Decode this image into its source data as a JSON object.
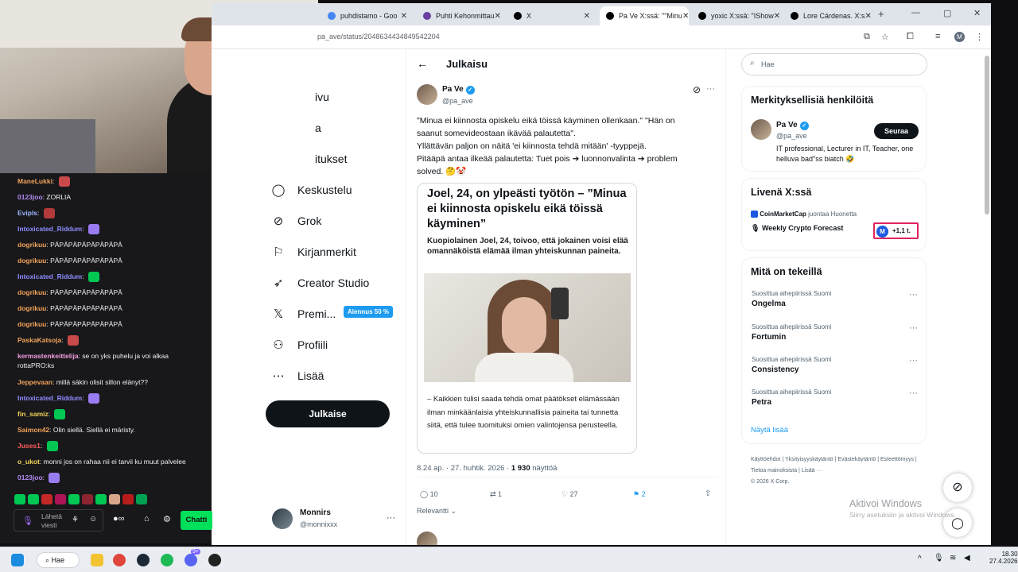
{
  "browser": {
    "tabs": [
      {
        "title": "puhdistamo - Goo",
        "color": "#4285f4"
      },
      {
        "title": "Puhti Kehonmittau",
        "color": "#6b3fa0"
      },
      {
        "title": "X",
        "color": "#000000"
      },
      {
        "title": "Pa Ve X:ssä: \"\"Minu",
        "color": "#000000"
      },
      {
        "title": "yoxic X:ssä: \"IShow",
        "color": "#000000"
      },
      {
        "title": "Lore Cárdenas. X:s",
        "color": "#000000"
      }
    ],
    "url": "pa_ave/status/2048634434849542204",
    "profile_letter": "M"
  },
  "nav": {
    "items": [
      {
        "label": "ivu",
        "icon": "home-icon"
      },
      {
        "label": "a",
        "icon": "explore-icon"
      },
      {
        "label": "itukset",
        "icon": "notifications-icon"
      },
      {
        "label": "Keskustelu",
        "icon": "chat-icon",
        "glyph": "◯"
      },
      {
        "label": "Grok",
        "icon": "grok-icon",
        "glyph": "⊘"
      },
      {
        "label": "Kirjanmerkit",
        "icon": "bookmark-icon",
        "glyph": "⚐"
      },
      {
        "label": "Creator Studio",
        "icon": "rocket-icon",
        "glyph": "➶"
      },
      {
        "label": "Premi...",
        "icon": "x-logo-icon",
        "glyph": "𝕏"
      },
      {
        "label": "Profiili",
        "icon": "profile-icon",
        "glyph": "⚇"
      },
      {
        "label": "Lisää",
        "icon": "more-icon",
        "glyph": "⋯"
      }
    ],
    "premium_badge": "Alennus 50 %",
    "post_button": "Julkaise",
    "account": {
      "name": "Monnirs",
      "handle": "@monnixxx"
    }
  },
  "post": {
    "header_title": "Julkaisu",
    "author_name": "Pa Ve",
    "author_handle": "@pa_ave",
    "text_lines": [
      "\"Minua ei kiinnosta opiskelu eikä töissä käyminen ollenkaan.\" \"Hän on",
      "saanut somevideostaan ikävää palautetta\".",
      "Yllättävän paljon on näitä 'ei kiinnosta tehdä mitään' -tyyppejä.",
      "Pitääpä antaa ilkeää palautetta: Tuet pois ➔ luonnonvalinta ➔ problem",
      "solved. 🤔🤡"
    ],
    "article": {
      "headline": "Joel, 24, on ylpeästi työtön – ”Minua ei kiinnosta opiskelu eikä töissä käyminen”",
      "lede": "Kuopiolainen Joel, 24, toivoo, että jokainen voisi elää omannäköistä elämää ilman yhteiskunnan paineita.",
      "quote": "– Kaikkien tulisi saada tehdä omat päätökset elämässään ilman minkäänlaisia yhteiskunnallisia paineita tai tunnetta siitä, että tulee tuomituksi omien valintojensa perusteella."
    },
    "timestamp": "8.24 ap. · 27. huhtik. 2026 · ",
    "views": "1 930",
    "views_label": "näyttöä",
    "replies": "10",
    "reposts": "1",
    "likes": "27",
    "bookmarks": "2",
    "sort_label": "Relevantti"
  },
  "sidebar": {
    "search_placeholder": "Hae",
    "relevant_title": "Merkityksellisiä henkilöitä",
    "person": {
      "name": "Pa Ve",
      "handle": "@pa_ave",
      "bio": "IT professional, Lecturer in IT, Teacher, one helluva bad\"ss biatch 🤣",
      "follow": "Seuraa"
    },
    "live_title": "Livenä X:ssä",
    "live": {
      "host": "CoinMarketCap",
      "action": "juontaa Huonetta",
      "room": "Weekly Crypto Forecast",
      "count": "+1,1 t."
    },
    "trends_title": "Mitä on tekeillä",
    "trends": [
      {
        "context": "Suosittua aihepiirissä Suomi",
        "name": "Ongelma"
      },
      {
        "context": "Suosittua aihepiirissä Suomi",
        "name": "Fortumin"
      },
      {
        "context": "Suosittua aihepiirissä Suomi",
        "name": "Consistency"
      },
      {
        "context": "Suosittua aihepiirissä Suomi",
        "name": "Petra"
      }
    ],
    "show_more": "Näytä lisää",
    "footer": [
      "Käyttöehdot",
      "Yksityisyyskäytäntö",
      "Evästekäytäntö",
      "Esteettömyys",
      "Tietoa mainoksista",
      "Lisää ···",
      "© 2026 X Corp."
    ],
    "watermark_title": "Aktivoi Windows",
    "watermark_sub": "Siirry asetuksiin ja aktivoi Windows."
  },
  "chat": {
    "messages": [
      {
        "user": "ManeLukki",
        "color": "#f2a35a",
        "text": ""
      },
      {
        "user": "0123joo",
        "color": "#b38cf2",
        "text": "ZORLIA"
      },
      {
        "user": "Evipls",
        "color": "#9cb7ff",
        "text": ""
      },
      {
        "user": "Intoxicated_Riddum",
        "color": "#8f8cff",
        "text": ""
      },
      {
        "user": "dogrikuu",
        "color": "#f2a35a",
        "text": "PÄPÄPÄPÄPÄPÄPÄPÄ"
      },
      {
        "user": "dogrikuu",
        "color": "#f2a35a",
        "text": "PÄPÄPÄPÄPÄPÄPÄPÄ"
      },
      {
        "user": "Intoxicated_Riddum",
        "color": "#8f8cff",
        "text": ""
      },
      {
        "user": "dogrikuu",
        "color": "#f2a35a",
        "text": "PÄPÄPÄPÄPÄPÄPÄPÄ"
      },
      {
        "user": "dogrikuu",
        "color": "#f2a35a",
        "text": "PÄPÄPÄPÄPÄPÄPÄPÄ"
      },
      {
        "user": "dogrikuu",
        "color": "#f2a35a",
        "text": "PÄPÄPÄPÄPÄPÄPÄPÄ"
      },
      {
        "user": "PaskaKatsoja",
        "color": "#f2a35a",
        "text": ""
      },
      {
        "user": "kermastenkeittelija",
        "color": "#f29de0",
        "text": "se on yks puhelu ja voi alkaa rottaPRO:ks"
      },
      {
        "user": "Jeppevaan",
        "color": "#f2a35a",
        "text": "millä säkin olisit sillon elänyt??"
      },
      {
        "user": "Intoxicated_Riddum",
        "color": "#8f8cff",
        "text": ""
      },
      {
        "user": "fin_samiz",
        "color": "#f2d35a",
        "text": ""
      },
      {
        "user": "Saimon42",
        "color": "#f2a35a",
        "text": "Olin siellä. Siellä ei märisty."
      },
      {
        "user": "Juses1",
        "color": "#ff5c5c",
        "text": ""
      },
      {
        "user": "o_ukot",
        "color": "#f2d35a",
        "text": "monni jos on rahaa nii ei tarvii ku muut palvelee"
      },
      {
        "user": "0123joo",
        "color": "#b38cf2",
        "text": ""
      }
    ],
    "input_placeholder": "Lähetä viesti",
    "chat_button": "Chatti"
  },
  "taskbar": {
    "search": "Hae",
    "time": "18.30",
    "date": "27.4.2026",
    "badge": "9+"
  }
}
